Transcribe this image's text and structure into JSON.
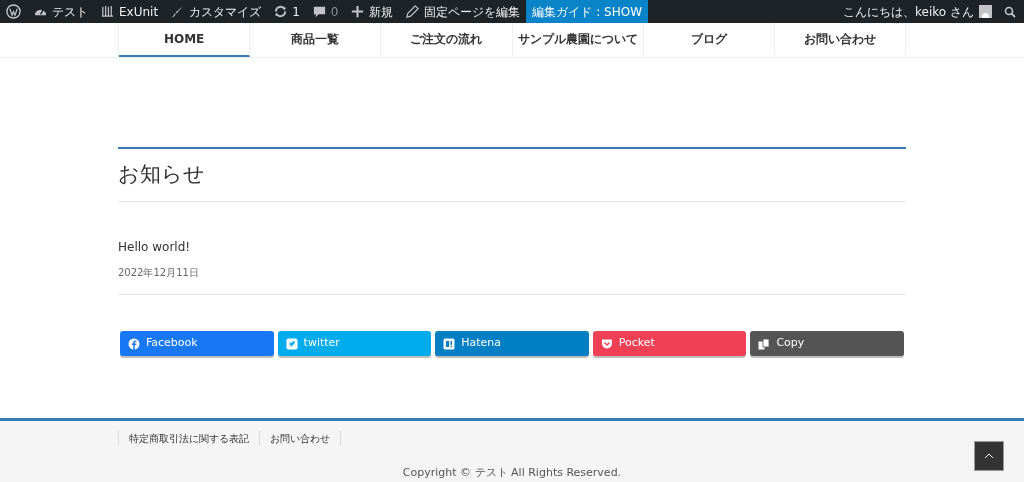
{
  "admin_bar": {
    "items": [
      {
        "kind": "wp"
      },
      {
        "kind": "dashboard",
        "label": "テスト"
      },
      {
        "kind": "exunit",
        "label": "ExUnit"
      },
      {
        "kind": "brush",
        "label": "カスタマイズ"
      },
      {
        "kind": "update",
        "label": "1"
      },
      {
        "kind": "comment",
        "label": "0"
      },
      {
        "kind": "plus",
        "label": "新規"
      },
      {
        "kind": "pencil",
        "label": "固定ページを編集"
      },
      {
        "kind": "guide",
        "label": "編集ガイド : SHOW"
      }
    ],
    "greeting": "こんにちは、keiko さん"
  },
  "nav": [
    {
      "label": "HOME",
      "selected": true
    },
    {
      "label": "商品一覧",
      "selected": false
    },
    {
      "label": "ご注文の流れ",
      "selected": false
    },
    {
      "label": "サンプル農園について",
      "selected": false
    },
    {
      "label": "ブログ",
      "selected": false
    },
    {
      "label": "お問い合わせ",
      "selected": false
    }
  ],
  "section_title": "お知らせ",
  "posts": [
    {
      "title": "Hello world!",
      "date": "2022年12月11日"
    }
  ],
  "share_buttons": [
    {
      "kind": "facebook",
      "label": "Facebook",
      "color": "#1877f2"
    },
    {
      "kind": "twitter",
      "label": "twitter",
      "color": "#00acee"
    },
    {
      "kind": "hatena",
      "label": "Hatena",
      "color": "#007fc5"
    },
    {
      "kind": "pocket",
      "label": "Pocket",
      "color": "#ef4056"
    },
    {
      "kind": "copy",
      "label": "Copy",
      "color": "#555555"
    }
  ],
  "footer": {
    "links": [
      "特定商取引法に関する表記",
      "お問い合わせ"
    ],
    "copyright": "Copyright © テスト All Rights Reserved."
  }
}
